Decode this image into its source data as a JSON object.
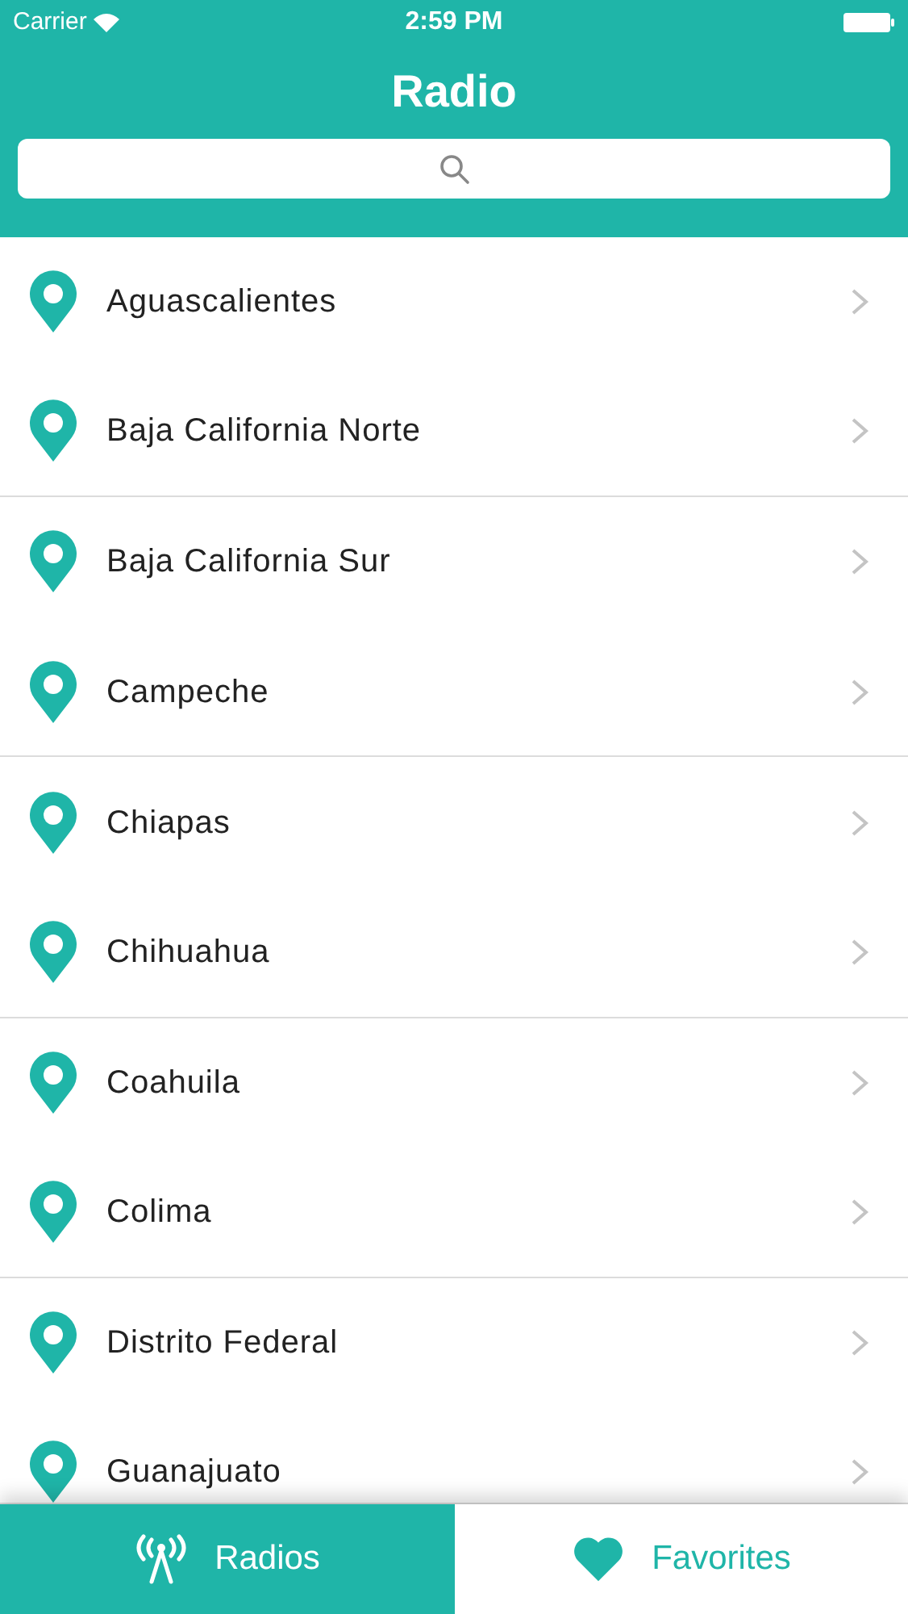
{
  "status_bar": {
    "carrier": "Carrier",
    "time": "2:59 PM"
  },
  "nav": {
    "title": "Radio"
  },
  "states": [
    {
      "name": "Aguascalientes"
    },
    {
      "name": "Baja California Norte"
    },
    {
      "name": "Baja California Sur"
    },
    {
      "name": "Campeche"
    },
    {
      "name": "Chiapas"
    },
    {
      "name": "Chihuahua"
    },
    {
      "name": "Coahuila"
    },
    {
      "name": "Colima"
    },
    {
      "name": "Distrito Federal"
    },
    {
      "name": "Guanajuato"
    }
  ],
  "tabs": [
    {
      "label": "Radios",
      "kind": "radio",
      "selected": true
    },
    {
      "label": "Favorites",
      "kind": "heart",
      "selected": false
    }
  ]
}
